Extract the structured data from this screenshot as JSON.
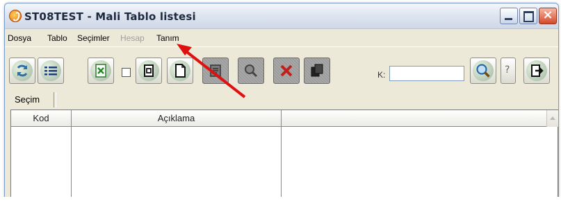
{
  "window": {
    "title": "ST08TEST - Mali Tablo listesi"
  },
  "menu": [
    {
      "label": "Dosya",
      "disabled": false
    },
    {
      "label": "Tablo",
      "disabled": false
    },
    {
      "label": "Seçimler",
      "disabled": false
    },
    {
      "label": "Hesap",
      "disabled": true
    },
    {
      "label": "Tanım",
      "disabled": false
    }
  ],
  "toolbar": {
    "buttons": [
      "refresh-icon",
      "list-icon",
      "excel-export-icon",
      "copy-document-icon",
      "new-document-icon",
      "print-icon",
      "search-icon",
      "delete-icon",
      "duplicate-icon",
      "find-icon",
      "help-icon",
      "exit-icon"
    ],
    "search_label": "K:",
    "search_value": ""
  },
  "secim": {
    "label": "Seçim"
  },
  "table": {
    "columns": [
      "Kod",
      "Açıklama",
      ""
    ]
  },
  "annotation": {
    "arrow_color": "#e01010"
  }
}
